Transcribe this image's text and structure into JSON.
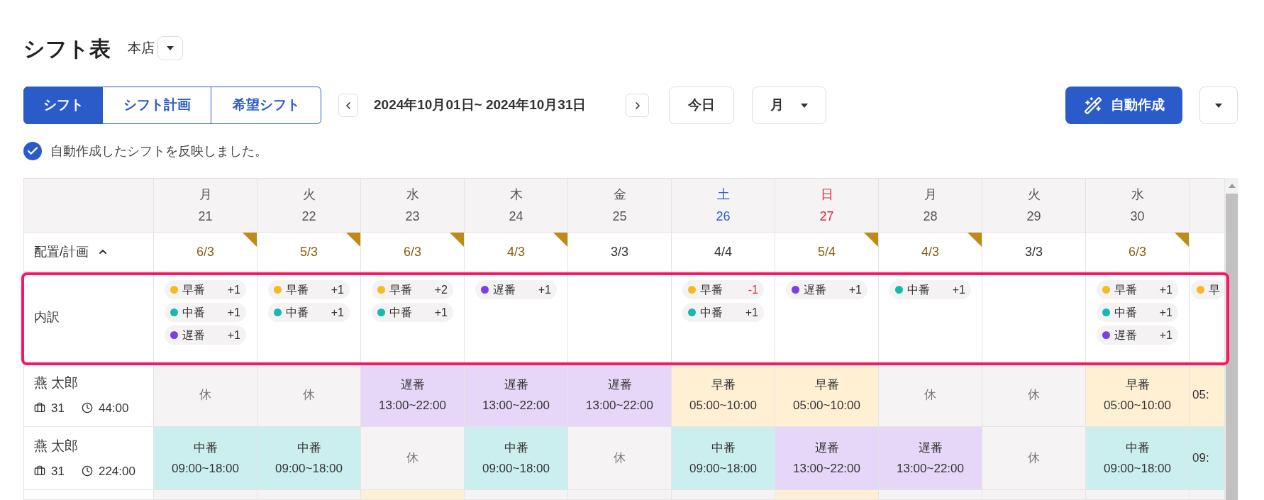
{
  "title": "シフト表",
  "store": {
    "value": "本店"
  },
  "tabs": [
    {
      "label": "シフト",
      "selected": true
    },
    {
      "label": "シフト計画",
      "selected": false
    },
    {
      "label": "希望シフト",
      "selected": false
    }
  ],
  "date_range": "2024年10月01日~ 2024年10月31日",
  "today_button": "今日",
  "view_select": {
    "value": "月"
  },
  "auto_button": "自動作成",
  "notice": "自動作成したシフトを反映しました。",
  "plan_row": {
    "label": "配置/計画",
    "expanded": true
  },
  "breakdown_row": {
    "label": "内訳",
    "highlighted": true
  },
  "days": [
    {
      "weekday": "月",
      "date": "21",
      "color": "#555555",
      "plan": "6/3",
      "flagged": true,
      "breakdown": [
        {
          "label": "早番",
          "color": "#f9b820",
          "delta": "+1",
          "negative": false
        },
        {
          "label": "中番",
          "color": "#16b8b2",
          "delta": "+1",
          "negative": false
        },
        {
          "label": "遅番",
          "color": "#7a3ee6",
          "delta": "+1",
          "negative": false
        }
      ]
    },
    {
      "weekday": "火",
      "date": "22",
      "color": "#555555",
      "plan": "5/3",
      "flagged": true,
      "breakdown": [
        {
          "label": "早番",
          "color": "#f9b820",
          "delta": "+1",
          "negative": false
        },
        {
          "label": "中番",
          "color": "#16b8b2",
          "delta": "+1",
          "negative": false
        }
      ]
    },
    {
      "weekday": "水",
      "date": "23",
      "color": "#555555",
      "plan": "6/3",
      "flagged": true,
      "breakdown": [
        {
          "label": "早番",
          "color": "#f9b820",
          "delta": "+2",
          "negative": false
        },
        {
          "label": "中番",
          "color": "#16b8b2",
          "delta": "+1",
          "negative": false
        }
      ]
    },
    {
      "weekday": "木",
      "date": "24",
      "color": "#555555",
      "plan": "4/3",
      "flagged": true,
      "breakdown": [
        {
          "label": "遅番",
          "color": "#7a3ee6",
          "delta": "+1",
          "negative": false
        }
      ]
    },
    {
      "weekday": "金",
      "date": "25",
      "color": "#555555",
      "plan": "3/3",
      "flagged": false
    },
    {
      "weekday": "土",
      "date": "26",
      "color": "#2a5bc9",
      "plan": "4/4",
      "flagged": false,
      "breakdown": [
        {
          "label": "早番",
          "color": "#f9b820",
          "delta": "-1",
          "negative": true
        },
        {
          "label": "中番",
          "color": "#16b8b2",
          "delta": "+1",
          "negative": false
        }
      ]
    },
    {
      "weekday": "日",
      "date": "27",
      "color": "#e0263f",
      "plan": "5/4",
      "flagged": true,
      "breakdown": [
        {
          "label": "遅番",
          "color": "#7a3ee6",
          "delta": "+1",
          "negative": false
        }
      ]
    },
    {
      "weekday": "月",
      "date": "28",
      "color": "#555555",
      "plan": "4/3",
      "flagged": true,
      "breakdown": [
        {
          "label": "中番",
          "color": "#16b8b2",
          "delta": "+1",
          "negative": false
        }
      ]
    },
    {
      "weekday": "火",
      "date": "29",
      "color": "#555555",
      "plan": "3/3",
      "flagged": false
    },
    {
      "weekday": "水",
      "date": "30",
      "color": "#555555",
      "plan": "6/3",
      "flagged": true,
      "breakdown": [
        {
          "label": "早番",
          "color": "#f9b820",
          "delta": "+1",
          "negative": false
        },
        {
          "label": "中番",
          "color": "#16b8b2",
          "delta": "+1",
          "negative": false
        },
        {
          "label": "遅番",
          "color": "#7a3ee6",
          "delta": "+1",
          "negative": false
        }
      ]
    },
    {
      "breakdown": [
        {
          "label": "早",
          "color": "#f9b820"
        }
      ]
    }
  ],
  "employees": [
    {
      "name": "燕 太郎",
      "days_count": "31",
      "hours": "44:00",
      "shifts": [
        {
          "kind": "rest",
          "label": "休"
        },
        {
          "kind": "rest",
          "label": "休"
        },
        {
          "kind": "late",
          "label": "遅番",
          "time": "13:00~22:00"
        },
        {
          "kind": "late",
          "label": "遅番",
          "time": "13:00~22:00"
        },
        {
          "kind": "late",
          "label": "遅番",
          "time": "13:00~22:00"
        },
        {
          "kind": "early",
          "label": "早番",
          "time": "05:00~10:00"
        },
        {
          "kind": "early",
          "label": "早番",
          "time": "05:00~10:00"
        },
        {
          "kind": "rest",
          "label": "休"
        },
        {
          "kind": "rest",
          "label": "休"
        },
        {
          "kind": "early",
          "label": "早番",
          "time": "05:00~10:00"
        },
        {
          "kind": "early",
          "time": "05:"
        }
      ]
    },
    {
      "name": "燕 太郎",
      "days_count": "31",
      "hours": "224:00",
      "shifts": [
        {
          "kind": "mid",
          "label": "中番",
          "time": "09:00~18:00"
        },
        {
          "kind": "mid",
          "label": "中番",
          "time": "09:00~18:00"
        },
        {
          "kind": "rest",
          "label": "休"
        },
        {
          "kind": "mid",
          "label": "中番",
          "time": "09:00~18:00"
        },
        {
          "kind": "rest",
          "label": "休"
        },
        {
          "kind": "mid",
          "label": "中番",
          "time": "09:00~18:00"
        },
        {
          "kind": "late",
          "label": "遅番",
          "time": "13:00~22:00"
        },
        {
          "kind": "late",
          "label": "遅番",
          "time": "13:00~22:00"
        },
        {
          "kind": "rest",
          "label": "休"
        },
        {
          "kind": "mid",
          "label": "中番",
          "time": "09:00~18:00"
        },
        {
          "kind": "mid",
          "time": "09:"
        }
      ]
    },
    {
      "shifts": [
        {
          "kind": "rest"
        },
        {
          "kind": "rest"
        },
        {
          "kind": "early"
        },
        {
          "kind": "rest"
        },
        {
          "kind": "rest"
        },
        {
          "kind": "rest"
        },
        {
          "kind": "early"
        },
        {
          "kind": "rest"
        },
        {
          "kind": "rest"
        },
        {
          "kind": "rest"
        },
        {
          "kind": "rest"
        }
      ]
    }
  ]
}
